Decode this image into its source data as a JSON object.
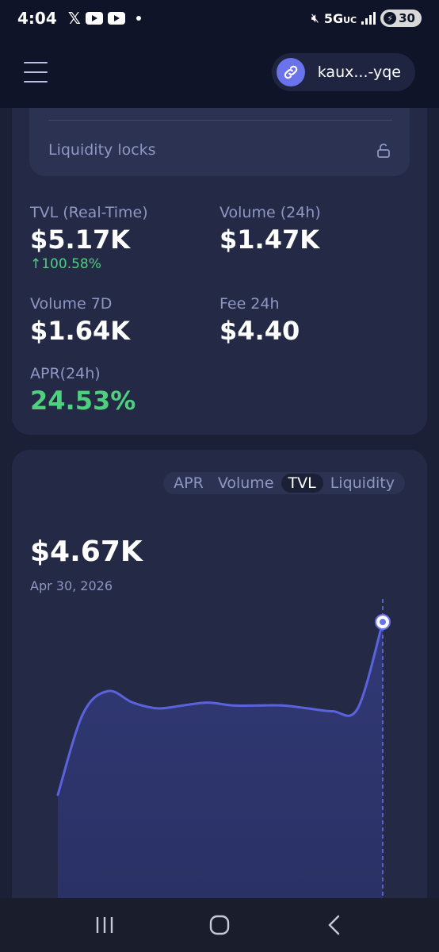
{
  "status_bar": {
    "time": "4:04",
    "network": "5G",
    "network_suffix": "UC",
    "battery": "30"
  },
  "header": {
    "wallet_label": "kaux...-yqe"
  },
  "liquidity": {
    "locks_label": "Liquidity locks"
  },
  "stats": {
    "tvl_label": "TVL (Real-Time)",
    "tvl_value": "$5.17K",
    "tvl_change": "↑100.58%",
    "volume24_label": "Volume (24h)",
    "volume24_value": "$1.47K",
    "volume7_label": "Volume 7D",
    "volume7_value": "$1.64K",
    "fee24_label": "Fee 24h",
    "fee24_value": "$4.40",
    "apr_label": "APR(24h)",
    "apr_value": "24.53%"
  },
  "chart": {
    "tabs": [
      "APR",
      "Volume",
      "TVL",
      "Liquidity"
    ],
    "active_tab": "TVL",
    "current_value": "$4.67K",
    "current_date": "Apr 30, 2026"
  },
  "chart_data": {
    "type": "area",
    "series": [
      {
        "values": [
          0.4,
          0.68,
          0.76,
          0.72,
          0.7,
          0.71,
          0.72,
          0.71,
          0.71,
          0.71,
          0.7,
          0.69,
          0.7,
          1.0
        ]
      }
    ],
    "highlight_index": 13,
    "grid": false,
    "colors": {
      "line": "#5a63dd",
      "fill": "#2f3770"
    }
  },
  "colors": {
    "background": "#1b2036",
    "card": "#242a45",
    "accent": "#6b73ec",
    "positive": "#4fd07f",
    "muted_text": "#8e97c4"
  }
}
